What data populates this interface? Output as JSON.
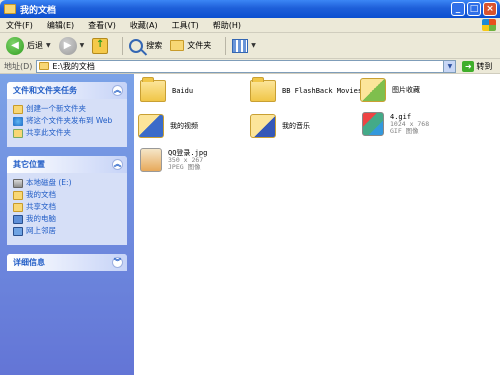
{
  "window": {
    "title": "我的文档",
    "buttons": [
      "_",
      "□",
      "×"
    ]
  },
  "menubar": {
    "items": [
      "文件(F)",
      "编辑(E)",
      "查看(V)",
      "收藏(A)",
      "工具(T)",
      "帮助(H)"
    ]
  },
  "toolbar": {
    "back_label": "后退",
    "search_label": "搜索",
    "folders_label": "文件夹"
  },
  "address": {
    "label": "地址(D)",
    "value": "E:\\我的文档",
    "go_label": "转到"
  },
  "left": {
    "tasks": {
      "title": "文件和文件夹任务",
      "items": [
        "创建一个新文件夹",
        "将这个文件夹发布到 Web",
        "共享此文件夹"
      ]
    },
    "places": {
      "title": "其它位置",
      "items": [
        "本地磁盘 (E:)",
        "我的文档",
        "共享文档",
        "我的电脑",
        "网上邻居"
      ]
    },
    "details": {
      "title": "详细信息"
    }
  },
  "files": [
    {
      "name": "Baidu"
    },
    {
      "name": "BB FlashBack Movies"
    },
    {
      "name": "图片收藏"
    },
    {
      "name": "我的视频"
    },
    {
      "name": "我的音乐"
    },
    {
      "name": "4.gif",
      "dims": "1024 x 768",
      "type": "GIF 图像"
    },
    {
      "name": "QQ登录.jpg",
      "dims": "350 x 267",
      "type": "JPEG 图像"
    }
  ]
}
